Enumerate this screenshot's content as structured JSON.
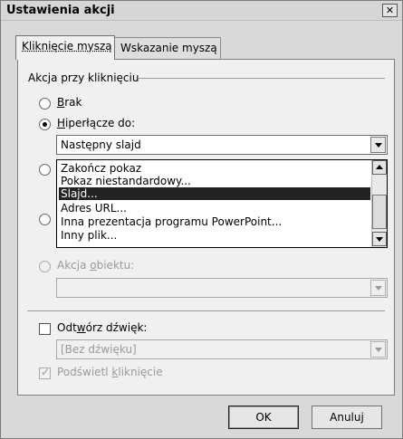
{
  "window": {
    "title": "Ustawienia akcji",
    "close_label": "✕"
  },
  "tabs": [
    {
      "label": "Kliknięcie myszą",
      "active": true
    },
    {
      "label": "Wskazanie myszą",
      "active": false
    }
  ],
  "group": {
    "label": "Akcja przy kliknięciu"
  },
  "options": {
    "none": {
      "label_underlined": "B",
      "label_rest": "rak"
    },
    "hyperlink": {
      "label_underlined": "H",
      "label_rest": "iperłącze do:"
    },
    "object_action": {
      "label_pre": "Akcja ",
      "label_underlined": "o",
      "label_rest": "biektu:"
    }
  },
  "hyperlink_combo": {
    "value": "Następny slajd"
  },
  "dropdown_list": {
    "items": [
      "Zakończ pokaz",
      "Pokaz niestandardowy...",
      "Slajd...",
      "Adres URL...",
      "Inna prezentacja programu PowerPoint...",
      "Inny plik..."
    ],
    "selected_index": 2
  },
  "object_action_combo": {
    "value": ""
  },
  "sound": {
    "label_pre": "Odt",
    "label_underlined": "w",
    "label_rest": "órz dźwięk:",
    "combo_value": "[Bez dźwięku]"
  },
  "highlight": {
    "label_pre": "Podświetl ",
    "label_underlined": "k",
    "label_rest": "liknięcie"
  },
  "buttons": {
    "ok": "OK",
    "cancel": "Anuluj"
  }
}
